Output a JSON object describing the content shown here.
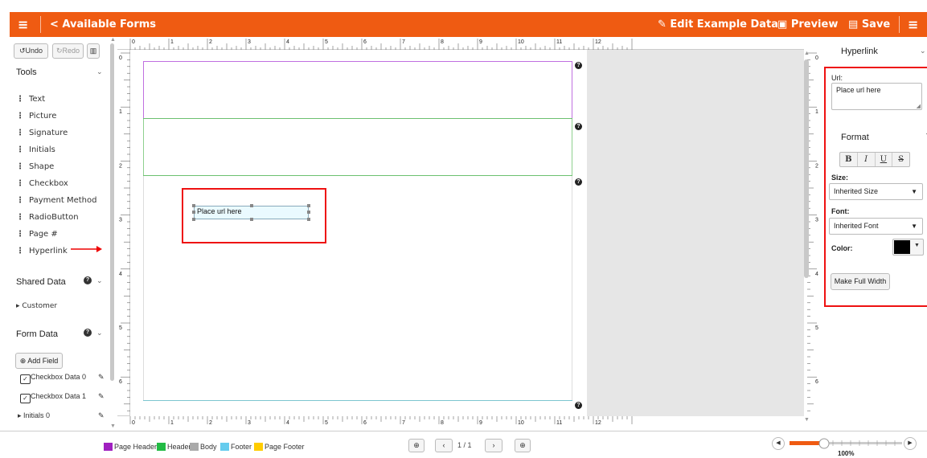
{
  "topbar": {
    "menu_icon": "hamburger-icon",
    "back_label": "< Available Forms",
    "edit_label": "Edit Example Data",
    "preview_label": "Preview",
    "save_label": "Save",
    "menu_right_icon": "hamburger-icon",
    "bg_color": "#ef5b12"
  },
  "toolbar": {
    "undo_label": "Undo",
    "redo_label": "Redo",
    "trash_icon": "trash-icon"
  },
  "tools": {
    "heading": "Tools",
    "items": [
      {
        "label": "Text"
      },
      {
        "label": "Picture"
      },
      {
        "label": "Signature"
      },
      {
        "label": "Initials"
      },
      {
        "label": "Shape"
      },
      {
        "label": "Checkbox"
      },
      {
        "label": "Payment Method"
      },
      {
        "label": "RadioButton"
      },
      {
        "label": "Page #"
      },
      {
        "label": "Hyperlink"
      }
    ]
  },
  "shared_data": {
    "heading": "Shared Data",
    "items": [
      {
        "label": "Customer"
      }
    ]
  },
  "form_data": {
    "heading": "Form Data",
    "add_field_label": "Add Field",
    "items": [
      {
        "label": "Checkbox Data 0"
      },
      {
        "label": "Checkbox Data 1"
      },
      {
        "label": "Initials 0"
      }
    ]
  },
  "canvas": {
    "hyperlink_text": "Place url here"
  },
  "props": {
    "hyperlink_heading": "Hyperlink",
    "url_label": "Url:",
    "url_value": "Place url here",
    "format_heading": "Format",
    "bold": "B",
    "italic": "I",
    "underline": "U",
    "strike": "S",
    "size_label": "Size:",
    "size_value": "Inherited Size",
    "font_label": "Font:",
    "font_value": "Inherited Font",
    "color_label": "Color:",
    "color_value": "#000000",
    "full_width_label": "Make Full Width"
  },
  "legend": {
    "items": [
      {
        "label": "Page Header",
        "color": "#a020c0"
      },
      {
        "label": "Header",
        "color": "#22bb44"
      },
      {
        "label": "Body",
        "color": "#aaaaaa"
      },
      {
        "label": "Footer",
        "color": "#66ccee"
      },
      {
        "label": "Page Footer",
        "color": "#ffcc00"
      }
    ]
  },
  "pager": {
    "page_text": "1 / 1"
  },
  "zoom": {
    "value_label": "100%",
    "level": 0.25
  },
  "ruler": {
    "top_numbers": [
      "0",
      "1",
      "2",
      "3",
      "4",
      "5",
      "6",
      "7",
      "8",
      "9",
      "10",
      "11",
      "12"
    ],
    "side_numbers": [
      "0",
      "1",
      "2",
      "3",
      "4",
      "5",
      "6"
    ]
  }
}
